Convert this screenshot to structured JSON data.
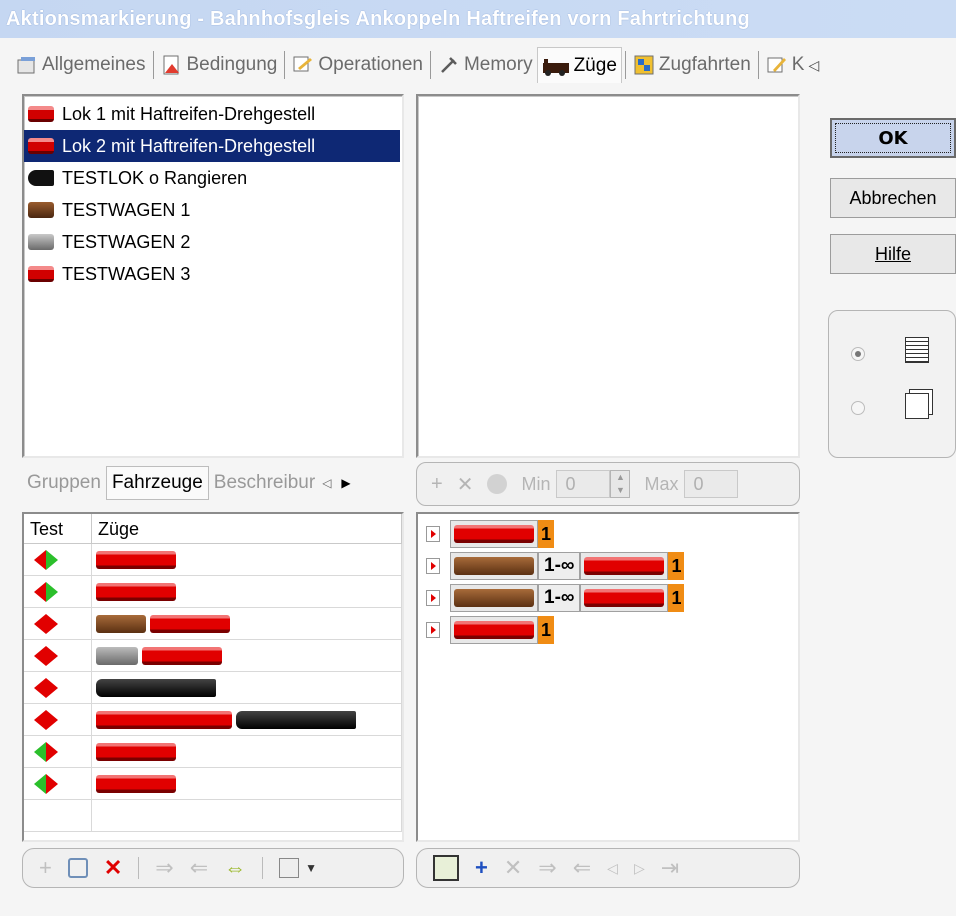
{
  "window": {
    "title": "Aktionsmarkierung - Bahnhofsgleis  Ankoppeln Haftreifen vorn Fahrtrichtung"
  },
  "tabs": [
    {
      "label": "Allgemeines",
      "icon": "properties-icon",
      "active": false
    },
    {
      "label": "Bedingung",
      "icon": "condition-icon",
      "active": false
    },
    {
      "label": "Operationen",
      "icon": "operations-icon",
      "active": false
    },
    {
      "label": "Memory",
      "icon": "memory-icon",
      "active": false
    },
    {
      "label": "Züge",
      "icon": "train-icon",
      "active": true
    },
    {
      "label": "Zugfahrten",
      "icon": "train-routes-icon",
      "active": false
    },
    {
      "label": "K",
      "icon": "edit-icon",
      "active": false
    }
  ],
  "vehicle_list": [
    {
      "label": "Lok 1 mit Haftreifen-Drehgestell",
      "icon": "red-locomotive-icon",
      "selected": false
    },
    {
      "label": "Lok 2 mit Haftreifen-Drehgestell",
      "icon": "red-locomotive-icon",
      "selected": true
    },
    {
      "label": "TESTLOK o Rangieren",
      "icon": "steam-locomotive-icon",
      "selected": false
    },
    {
      "label": "TESTWAGEN 1",
      "icon": "freight-wagon-icon",
      "selected": false
    },
    {
      "label": "TESTWAGEN 2",
      "icon": "hopper-wagon-icon",
      "selected": false
    },
    {
      "label": "TESTWAGEN 3",
      "icon": "railcar-icon",
      "selected": false
    }
  ],
  "subtabs": [
    {
      "label": "Gruppen",
      "active": false
    },
    {
      "label": "Fahrzeuge",
      "active": true
    },
    {
      "label": "Beschreibur",
      "active": false
    }
  ],
  "mid_toolbar": {
    "min_label": "Min",
    "min_value": "0",
    "max_label": "Max",
    "max_value": "0"
  },
  "table": {
    "headers": [
      "Test",
      "Züge"
    ],
    "rows": [
      {
        "test": "green-right",
        "vehicles": [
          "red"
        ]
      },
      {
        "test": "green-right",
        "vehicles": [
          "red"
        ]
      },
      {
        "test": "red-both",
        "vehicles": [
          "brown",
          "red"
        ]
      },
      {
        "test": "red-both",
        "vehicles": [
          "grey",
          "red"
        ]
      },
      {
        "test": "red-both",
        "vehicles": [
          "black"
        ]
      },
      {
        "test": "red-both",
        "vehicles": [
          "redlong",
          "black"
        ]
      },
      {
        "test": "green-left",
        "vehicles": [
          "red"
        ]
      },
      {
        "test": "green-left",
        "vehicles": [
          "red"
        ]
      }
    ]
  },
  "train_tree": [
    {
      "parts": [
        {
          "kind": "vehicle",
          "color": "red"
        },
        {
          "kind": "count",
          "text": "1"
        }
      ]
    },
    {
      "parts": [
        {
          "kind": "vehicle",
          "color": "brown"
        },
        {
          "kind": "range",
          "text": "1-∞"
        },
        {
          "kind": "vehicle",
          "color": "red"
        },
        {
          "kind": "count",
          "text": "1"
        }
      ]
    },
    {
      "parts": [
        {
          "kind": "vehicle",
          "color": "brown"
        },
        {
          "kind": "range",
          "text": "1-∞"
        },
        {
          "kind": "vehicle",
          "color": "red"
        },
        {
          "kind": "count",
          "text": "1"
        }
      ]
    },
    {
      "parts": [
        {
          "kind": "vehicle",
          "color": "red"
        },
        {
          "kind": "count",
          "text": "1"
        }
      ]
    }
  ],
  "buttons": {
    "ok": "OK",
    "cancel": "Abbrechen",
    "help": "Hilfe"
  },
  "colors": {
    "accent": "#0e2874",
    "count_bg": "#f08c14",
    "arrow_red": "#e10000",
    "arrow_green": "#2bbf2b"
  }
}
